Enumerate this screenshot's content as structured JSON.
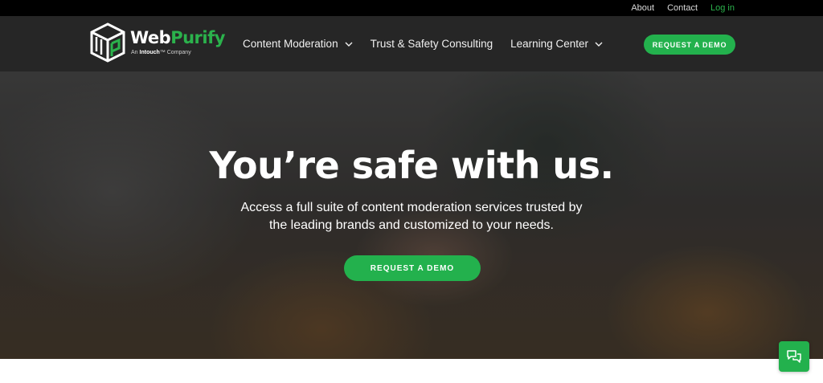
{
  "topbar": {
    "links": [
      {
        "label": "About"
      },
      {
        "label": "Contact"
      },
      {
        "label": "Log in"
      }
    ]
  },
  "logo": {
    "name_white": "Web",
    "name_green": "Purify",
    "tag_prefix": "An ",
    "tag_brand": "Intouch",
    "tag_suffix": "™ Company",
    "icon": "webpurify-cube-logo-icon"
  },
  "nav": {
    "items": [
      {
        "label": "Content Moderation",
        "has_dropdown": true
      },
      {
        "label": "Trust & Safety Consulting",
        "has_dropdown": false
      },
      {
        "label": "Learning Center",
        "has_dropdown": true
      }
    ],
    "cta_label": "REQUEST A DEMO"
  },
  "hero": {
    "title": "You’re safe with us.",
    "subtitle_line1": "Access a full suite of content moderation services trusted by",
    "subtitle_line2": "the leading brands and customized to your needs.",
    "cta_label": "REQUEST A DEMO"
  },
  "chat": {
    "icon": "chat-bubbles-icon"
  },
  "colors": {
    "accent_green": "#23b14d",
    "topbar_bg": "#000000",
    "nav_bg": "#262626",
    "login_link": "#2bb24c"
  }
}
